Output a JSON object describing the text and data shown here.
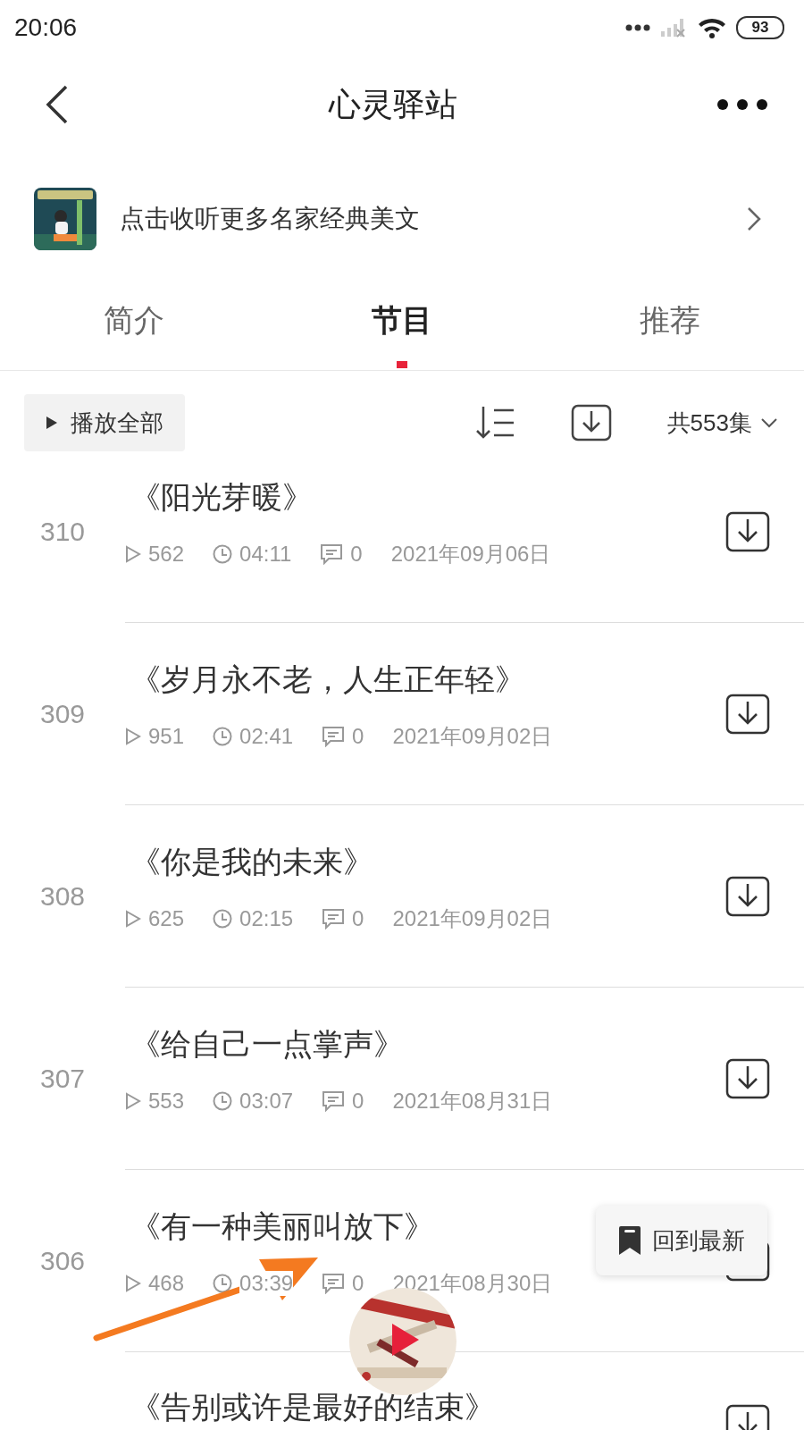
{
  "status_bar": {
    "time": "20:06",
    "battery": "93"
  },
  "header": {
    "title": "心灵驿站"
  },
  "banner": {
    "text": "点击收听更多名家经典美文"
  },
  "tabs": [
    {
      "label": "简介",
      "selected": false
    },
    {
      "label": "节目",
      "selected": true
    },
    {
      "label": "推荐",
      "selected": false
    }
  ],
  "toolbar": {
    "play_all": "播放全部",
    "count": "共553集"
  },
  "episodes": [
    {
      "number": "310",
      "title": "《阳光芽暖》",
      "plays": "562",
      "duration": "04:11",
      "comments": "0",
      "date": "2021年09月06日"
    },
    {
      "number": "309",
      "title": "《岁月永不老，人生正年轻》",
      "plays": "951",
      "duration": "02:41",
      "comments": "0",
      "date": "2021年09月02日"
    },
    {
      "number": "308",
      "title": "《你是我的未来》",
      "plays": "625",
      "duration": "02:15",
      "comments": "0",
      "date": "2021年09月02日"
    },
    {
      "number": "307",
      "title": "《给自己一点掌声》",
      "plays": "553",
      "duration": "03:07",
      "comments": "0",
      "date": "2021年08月31日"
    },
    {
      "number": "306",
      "title": "《有一种美丽叫放下》",
      "plays": "468",
      "duration": "03:39",
      "comments": "0",
      "date": "2021年08月30日"
    },
    {
      "title": "《告别或许是最好的结束》"
    }
  ],
  "back_to_latest": "回到最新"
}
